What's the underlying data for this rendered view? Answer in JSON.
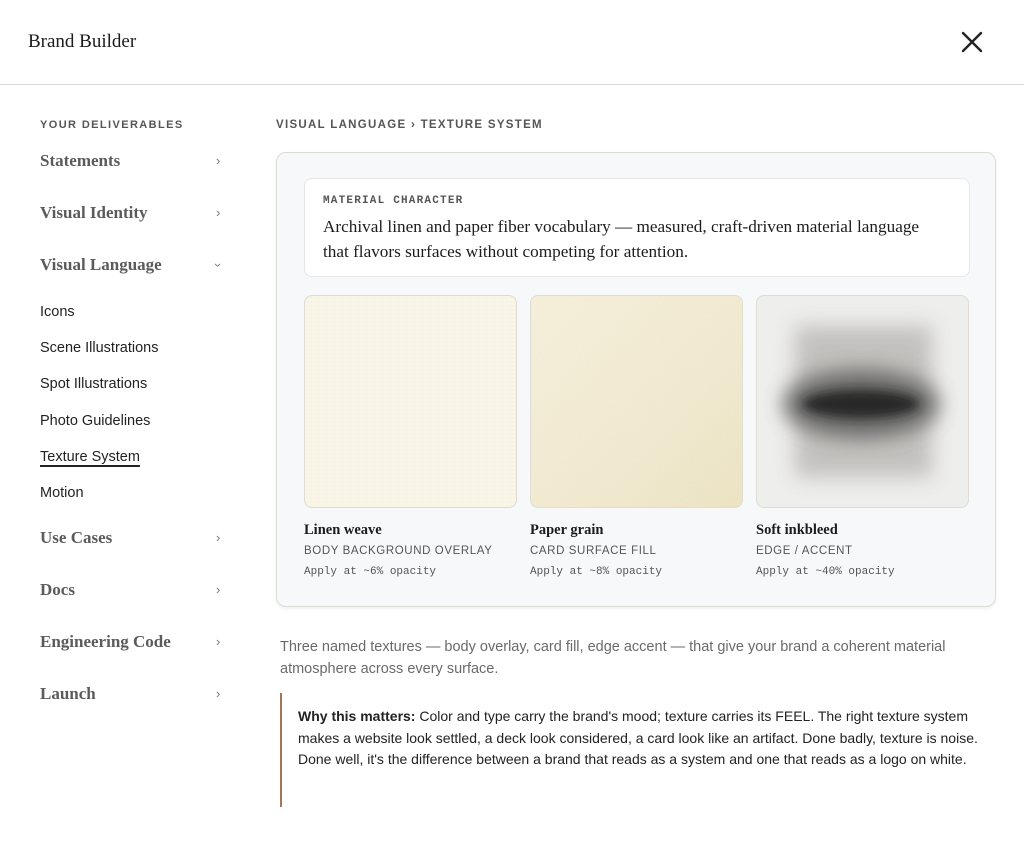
{
  "app": {
    "title": "Brand Builder"
  },
  "sidebar": {
    "heading": "YOUR DELIVERABLES",
    "sections": [
      {
        "label": "Statements",
        "expanded": false
      },
      {
        "label": "Visual Identity",
        "expanded": false
      },
      {
        "label": "Visual Language",
        "expanded": true,
        "items": [
          "Icons",
          "Scene Illustrations",
          "Spot Illustrations",
          "Photo Guidelines",
          "Texture System",
          "Motion"
        ],
        "active_item": "Texture System"
      },
      {
        "label": "Use Cases",
        "expanded": false
      },
      {
        "label": "Docs",
        "expanded": false
      },
      {
        "label": "Engineering Code",
        "expanded": false
      },
      {
        "label": "Launch",
        "expanded": false
      }
    ]
  },
  "breadcrumb": "VISUAL LANGUAGE › TEXTURE SYSTEM",
  "material": {
    "label": "MATERIAL CHARACTER",
    "text": "Archival linen and paper fiber vocabulary — measured, craft-driven material language that flavors surfaces without competing for attention."
  },
  "textures": [
    {
      "name": "Linen weave",
      "role": "BODY BACKGROUND OVERLAY",
      "opacity": "Apply at ~6% opacity"
    },
    {
      "name": "Paper grain",
      "role": "CARD SURFACE FILL",
      "opacity": "Apply at ~8% opacity"
    },
    {
      "name": "Soft inkbleed",
      "role": "EDGE / ACCENT",
      "opacity": "Apply at ~40% opacity"
    }
  ],
  "description": "Three named textures — body overlay, card fill, edge accent — that give your brand a coherent material atmosphere across every surface.",
  "why": {
    "label": "Why this matters:",
    "text": "Color and type carry the brand's mood; texture carries its FEEL. The right texture system makes a website look settled, a deck look considered, a card look like an artifact. Done badly, texture is noise. Done well, it's the difference between a brand that reads as a system and one that reads as a logo on white."
  },
  "colors": {
    "accent_border": "#a3765a",
    "panel_bg": "#f7f8f9"
  },
  "icons": {
    "close": "close-icon",
    "chevron": "chevron-right-icon"
  }
}
